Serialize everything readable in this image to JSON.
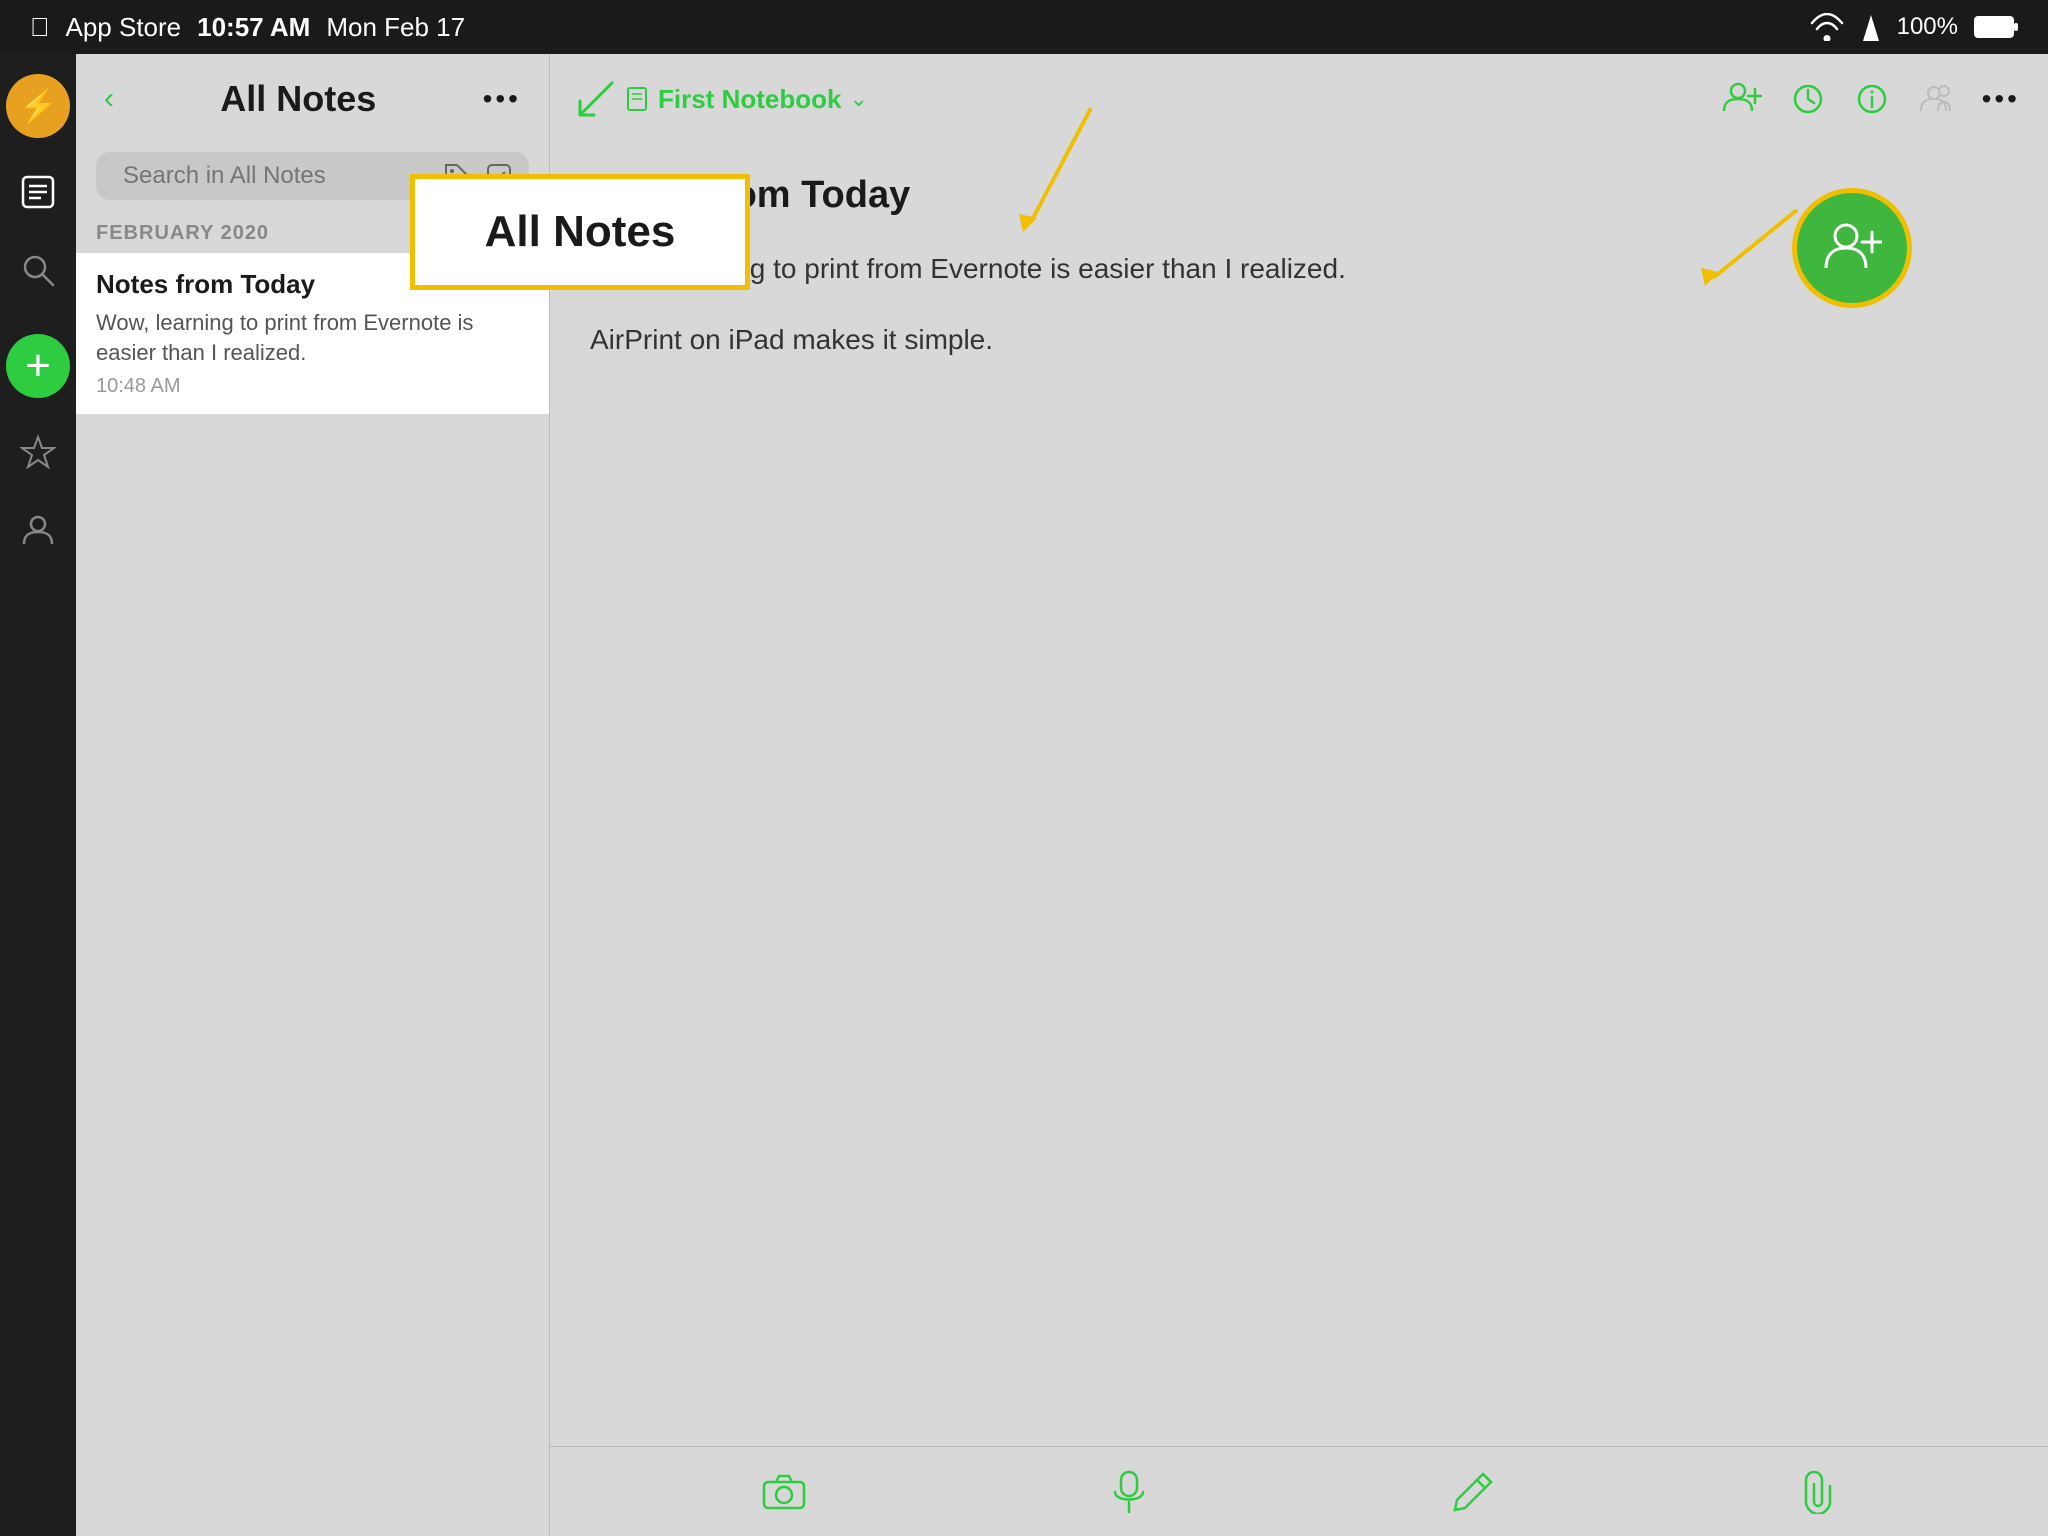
{
  "statusBar": {
    "appStore": "App Store",
    "time": "10:57 AM",
    "date": "Mon Feb 17",
    "battery": "100%"
  },
  "sidebar": {
    "avatarIcon": "⚡",
    "items": [
      {
        "label": "Notes",
        "icon": "📋",
        "active": true
      },
      {
        "label": "Search",
        "icon": "🔍",
        "active": false
      },
      {
        "label": "Favorites",
        "icon": "☆",
        "active": false
      },
      {
        "label": "Account",
        "icon": "👤",
        "active": false
      }
    ],
    "addLabel": "+"
  },
  "notesList": {
    "backButton": "‹",
    "title": "All Notes",
    "moreButton": "•••",
    "searchPlaceholder": "Search in All Notes",
    "dateSection": "FEBRUARY 2020",
    "notes": [
      {
        "title": "Notes from Today",
        "preview": "Wow, learning to print from Evernote is easier than I realized.",
        "time": "10:48 AM"
      }
    ]
  },
  "noteDetail": {
    "pencilIconLabel": "pencil-back",
    "notebookName": "First Notebook",
    "notebookChevron": "⌄",
    "shareIconLabel": "share",
    "moreButton": "•••",
    "noteTitle": "Notes from Today",
    "noteBody": [
      "Wow, learning to print from Evernote is easier than I realized.",
      "AirPrint on iPad makes it simple."
    ],
    "footerIcons": [
      "📷",
      "🎤",
      "✏️",
      "📎"
    ]
  },
  "callout": {
    "label": "All Notes"
  }
}
